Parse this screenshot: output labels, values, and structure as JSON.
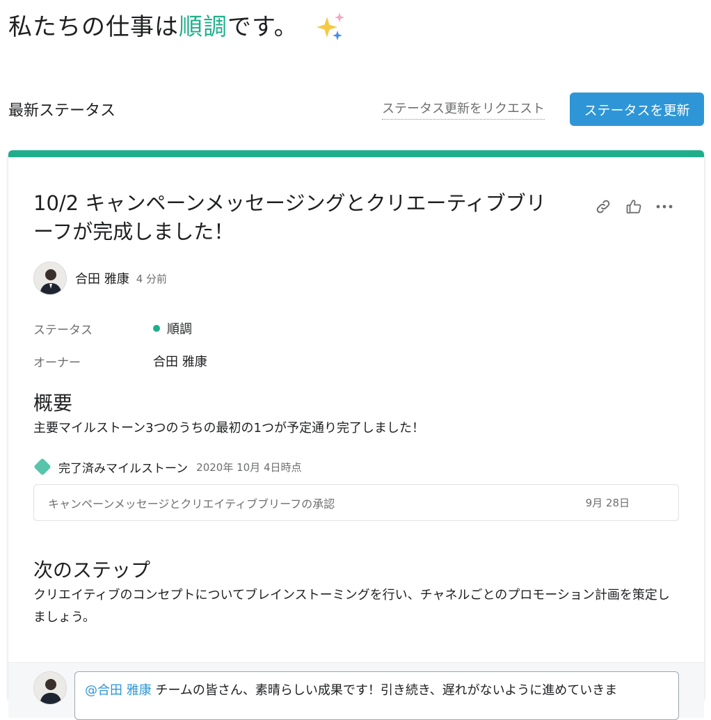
{
  "colors": {
    "accent_green": "#1fae8b",
    "primary_button": "#2e96d6",
    "milestone_diamond": "#58c4ab",
    "muted_text": "#6d6e6f"
  },
  "header": {
    "title_prefix": "私たちの仕事は",
    "title_status": "順調",
    "title_suffix": "です。",
    "icon": "sparkles-icon"
  },
  "status_bar": {
    "label": "最新ステータス",
    "request_link": "ステータス更新をリクエスト",
    "update_button": "ステータスを更新"
  },
  "card": {
    "title": "10/2 キャンペーンメッセージングとクリエーティブブリーフが完成しました！",
    "icons": [
      "link-icon",
      "thumbs-up-icon",
      "more-options-icon"
    ],
    "author": {
      "name": "合田 雅康",
      "time": "4 分前"
    },
    "fields": {
      "status_label": "ステータス",
      "status_value": "順調",
      "owner_label": "オーナー",
      "owner_value": "合田 雅康"
    },
    "summary": {
      "heading": "概要",
      "text": "主要マイルストーン3つのうちの最初の1つが予定通り完了しました！"
    },
    "milestones": {
      "label": "完了済みマイルストーン",
      "as_of": "2020年 10月 4日時点",
      "items": [
        {
          "name": "キャンペーンメッセージとクリエイティブブリーフの承認",
          "date": "9月 28日"
        }
      ]
    },
    "next_steps": {
      "heading": "次のステップ",
      "text": "クリエイティブのコンセプトについてブレインストーミングを行い、チャネルごとのプロモーション計画を策定しましょう。"
    },
    "comment": {
      "mention": "@合田 雅康",
      "text": "チームの皆さん、素晴らしい成果です！引き続き、遅れがないように進めていきま"
    }
  }
}
